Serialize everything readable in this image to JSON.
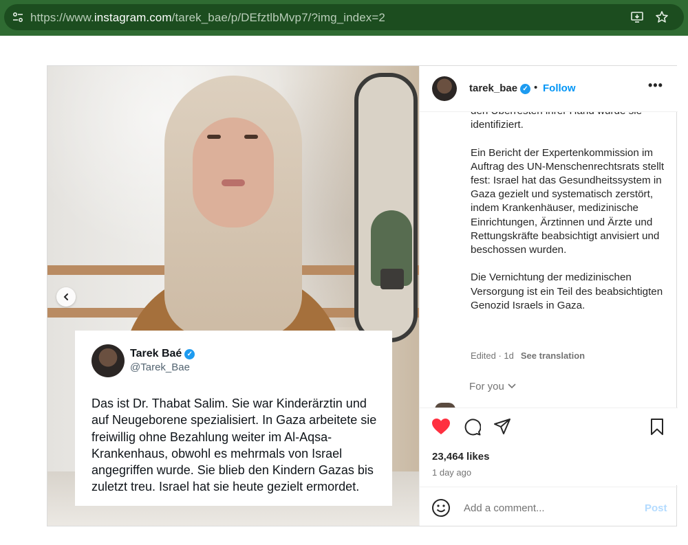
{
  "browser": {
    "url_prefix": "https://www.",
    "url_domain": "instagram.com",
    "url_path": "/tarek_bae/p/DEfztlbMvp7/?img_index=2",
    "site_info_icon": "tune-icon",
    "install_icon": "install-app-icon",
    "bookmark_icon": "star-icon"
  },
  "media": {
    "prev_icon": "chevron-left-icon",
    "tweet": {
      "name": "Tarek Baé",
      "verified_mark": "✓",
      "handle": "@Tarek_Bae",
      "text": "Das ist Dr. Thabat Salim. Sie war Kinderärztin und auf Neugeborene spezialisiert. In Gaza arbeitete sie freiwillig ohne Bezahlung weiter im Al-Aqsa-Krankenhaus, obwohl es mehrmals von Israel angegriffen wurde. Sie blieb den Kindern Gazas bis zuletzt treu. Israel hat sie heute gezielt ermordet."
    }
  },
  "header": {
    "username": "tarek_bae",
    "separator": "•",
    "follow_label": "Follow",
    "more_label": "•••"
  },
  "caption": {
    "para1": "den Überresten ihrer Hand wurde sie identifiziert.",
    "para2": "Ein Bericht der Expertenkommission im Auftrag des UN-Menschenrechtsrats stellt fest: Israel hat das Gesundheitssystem in Gaza gezielt und systematisch zerstört, indem Krankenhäuser, medizinische Einrichtungen, Ärztinnen und Ärzte und Rettungskräfte beabsichtigt anvisiert und beschossen wurden.",
    "para3": "Die Vernichtung der medizinischen Versorgung ist ein Teil des beabsichtigten Genozid Israels in Gaza.",
    "edited": "Edited · 1d",
    "see_translation": "See translation",
    "for_you": "For you"
  },
  "actions": {
    "like_icon": "heart-filled-icon",
    "comment_icon": "comment-icon",
    "share_icon": "send-icon",
    "save_icon": "bookmark-icon",
    "likes": "23,464 likes",
    "time": "1 day ago"
  },
  "comment": {
    "placeholder": "Add a comment...",
    "post_label": "Post"
  },
  "colors": {
    "accent": "#0095f6",
    "like": "#ff3040",
    "verified": "#1d9bf0"
  }
}
